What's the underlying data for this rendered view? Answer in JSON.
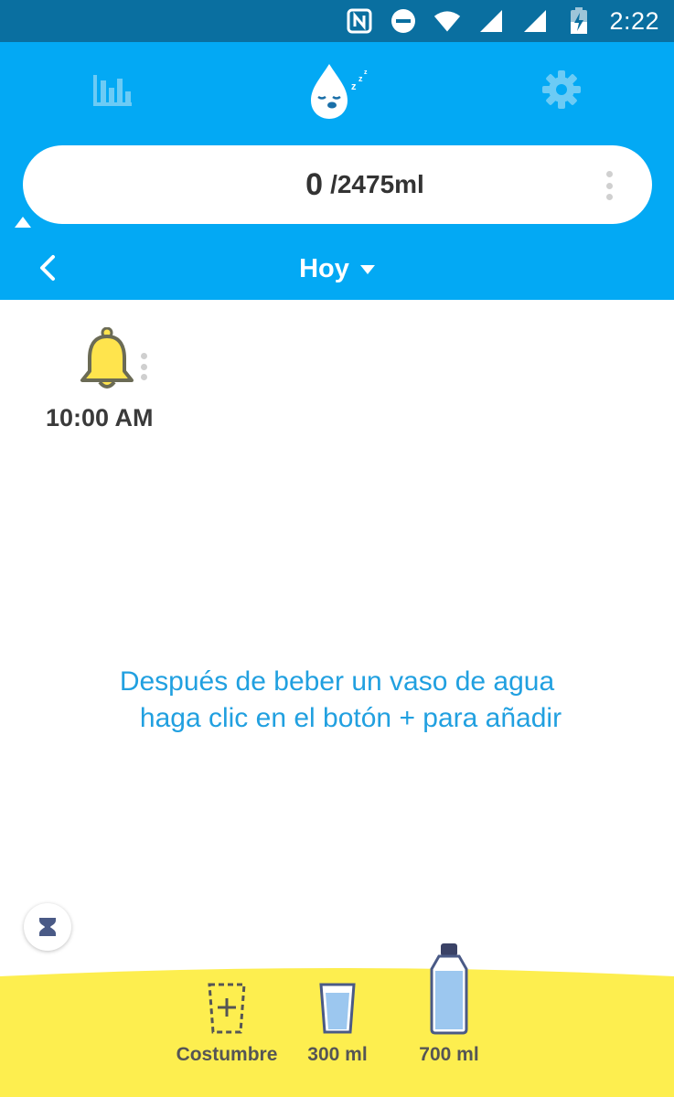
{
  "status_bar": {
    "time": "2:22",
    "icons": [
      "nfc-icon",
      "do-not-disturb-icon",
      "wifi-icon",
      "signal-icon",
      "signal-icon",
      "battery-charging-icon"
    ]
  },
  "toolbar": {
    "left_icon": "bar-chart-icon",
    "center_icon": "sleeping-water-drop-icon",
    "right_icon": "gear-icon"
  },
  "progress": {
    "current": "0",
    "target": "/2475ml"
  },
  "date_nav": {
    "label": "Hoy"
  },
  "reminder": {
    "time": "10:00 AM"
  },
  "hint": {
    "line1": "Después de beber un vaso de agua",
    "line2": "haga clic en el botón + para añadir"
  },
  "cups": [
    {
      "label": "Costumbre"
    },
    {
      "label": "300 ml"
    },
    {
      "label": "700 ml"
    }
  ],
  "colors": {
    "status_bar": "#0a6fa0",
    "header": "#03a9f4",
    "accent_text": "#21a0e0",
    "bottom": "#fdee4f",
    "bell": "#ffe44d"
  }
}
